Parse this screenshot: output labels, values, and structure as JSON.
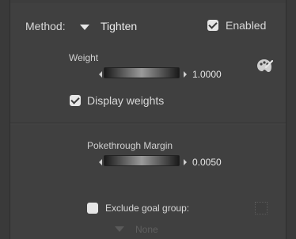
{
  "method": {
    "label": "Method:",
    "value": "Tighten"
  },
  "enabled": {
    "label": "Enabled",
    "checked": true
  },
  "weight": {
    "label": "Weight",
    "value": "1.0000"
  },
  "display_weights": {
    "label": "Display weights",
    "checked": true
  },
  "pokethrough": {
    "label": "Pokethrough Margin",
    "value": "0.0050"
  },
  "exclude_goal": {
    "label": "Exclude goal group:",
    "checked": false
  },
  "goal_group": {
    "value": "None"
  },
  "icons": {
    "paint": "paint-palette-icon"
  }
}
